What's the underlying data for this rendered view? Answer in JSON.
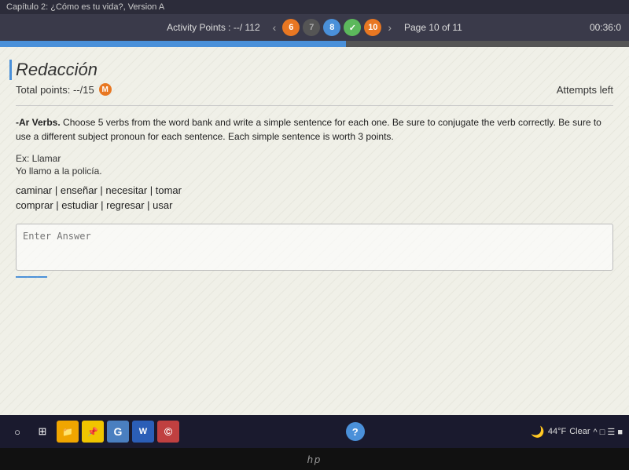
{
  "topbar": {
    "title": "Capítulo 2: ¿Cómo es tu vida?, Version A"
  },
  "activitybar": {
    "points_label": "Activity Points : --/ 112",
    "nav_items": [
      {
        "label": "6",
        "type": "orange"
      },
      {
        "label": "7",
        "type": "dark"
      },
      {
        "label": "8",
        "type": "blue"
      },
      {
        "label": "✓",
        "type": "checkmark"
      },
      {
        "label": "10",
        "type": "active"
      }
    ],
    "page_info": "Page 10 of 11",
    "timer": "00:36:0"
  },
  "content": {
    "section_title": "Redacción",
    "total_points": "Total points: --/15",
    "m_badge": "M",
    "attempts_label": "Attempts left",
    "instruction_bold": "-Ar Verbs.",
    "instruction_text": " Choose 5 verbs from the word bank and write a simple sentence for each one. Be sure to conjugate the verb correctly. Be sure to use a different subject pronoun for each sentence. Each simple sentence is worth 3 points.",
    "example_label": "Ex: Llamar",
    "example_sentence": "Yo llamo a la policía.",
    "word_bank_row1": "caminar | enseñar | necesitar | tomar",
    "word_bank_row2": "comprar | estudiar | regresar | usar",
    "answer_placeholder": "Enter Answer"
  },
  "taskbar": {
    "start_icon": "○",
    "apps": [
      {
        "label": "⊞",
        "type": "grid"
      },
      {
        "label": "📁",
        "type": "folder"
      },
      {
        "label": "📌",
        "type": "sticky"
      },
      {
        "label": "G",
        "type": "globe"
      },
      {
        "label": "W",
        "type": "word"
      },
      {
        "label": "©",
        "type": "app2"
      }
    ],
    "center_icon": "?",
    "weather": "44°F",
    "clear_label": "Clear",
    "time_date": "^ □ ☰ ■"
  },
  "hp_bar": {
    "logo": "hp"
  }
}
